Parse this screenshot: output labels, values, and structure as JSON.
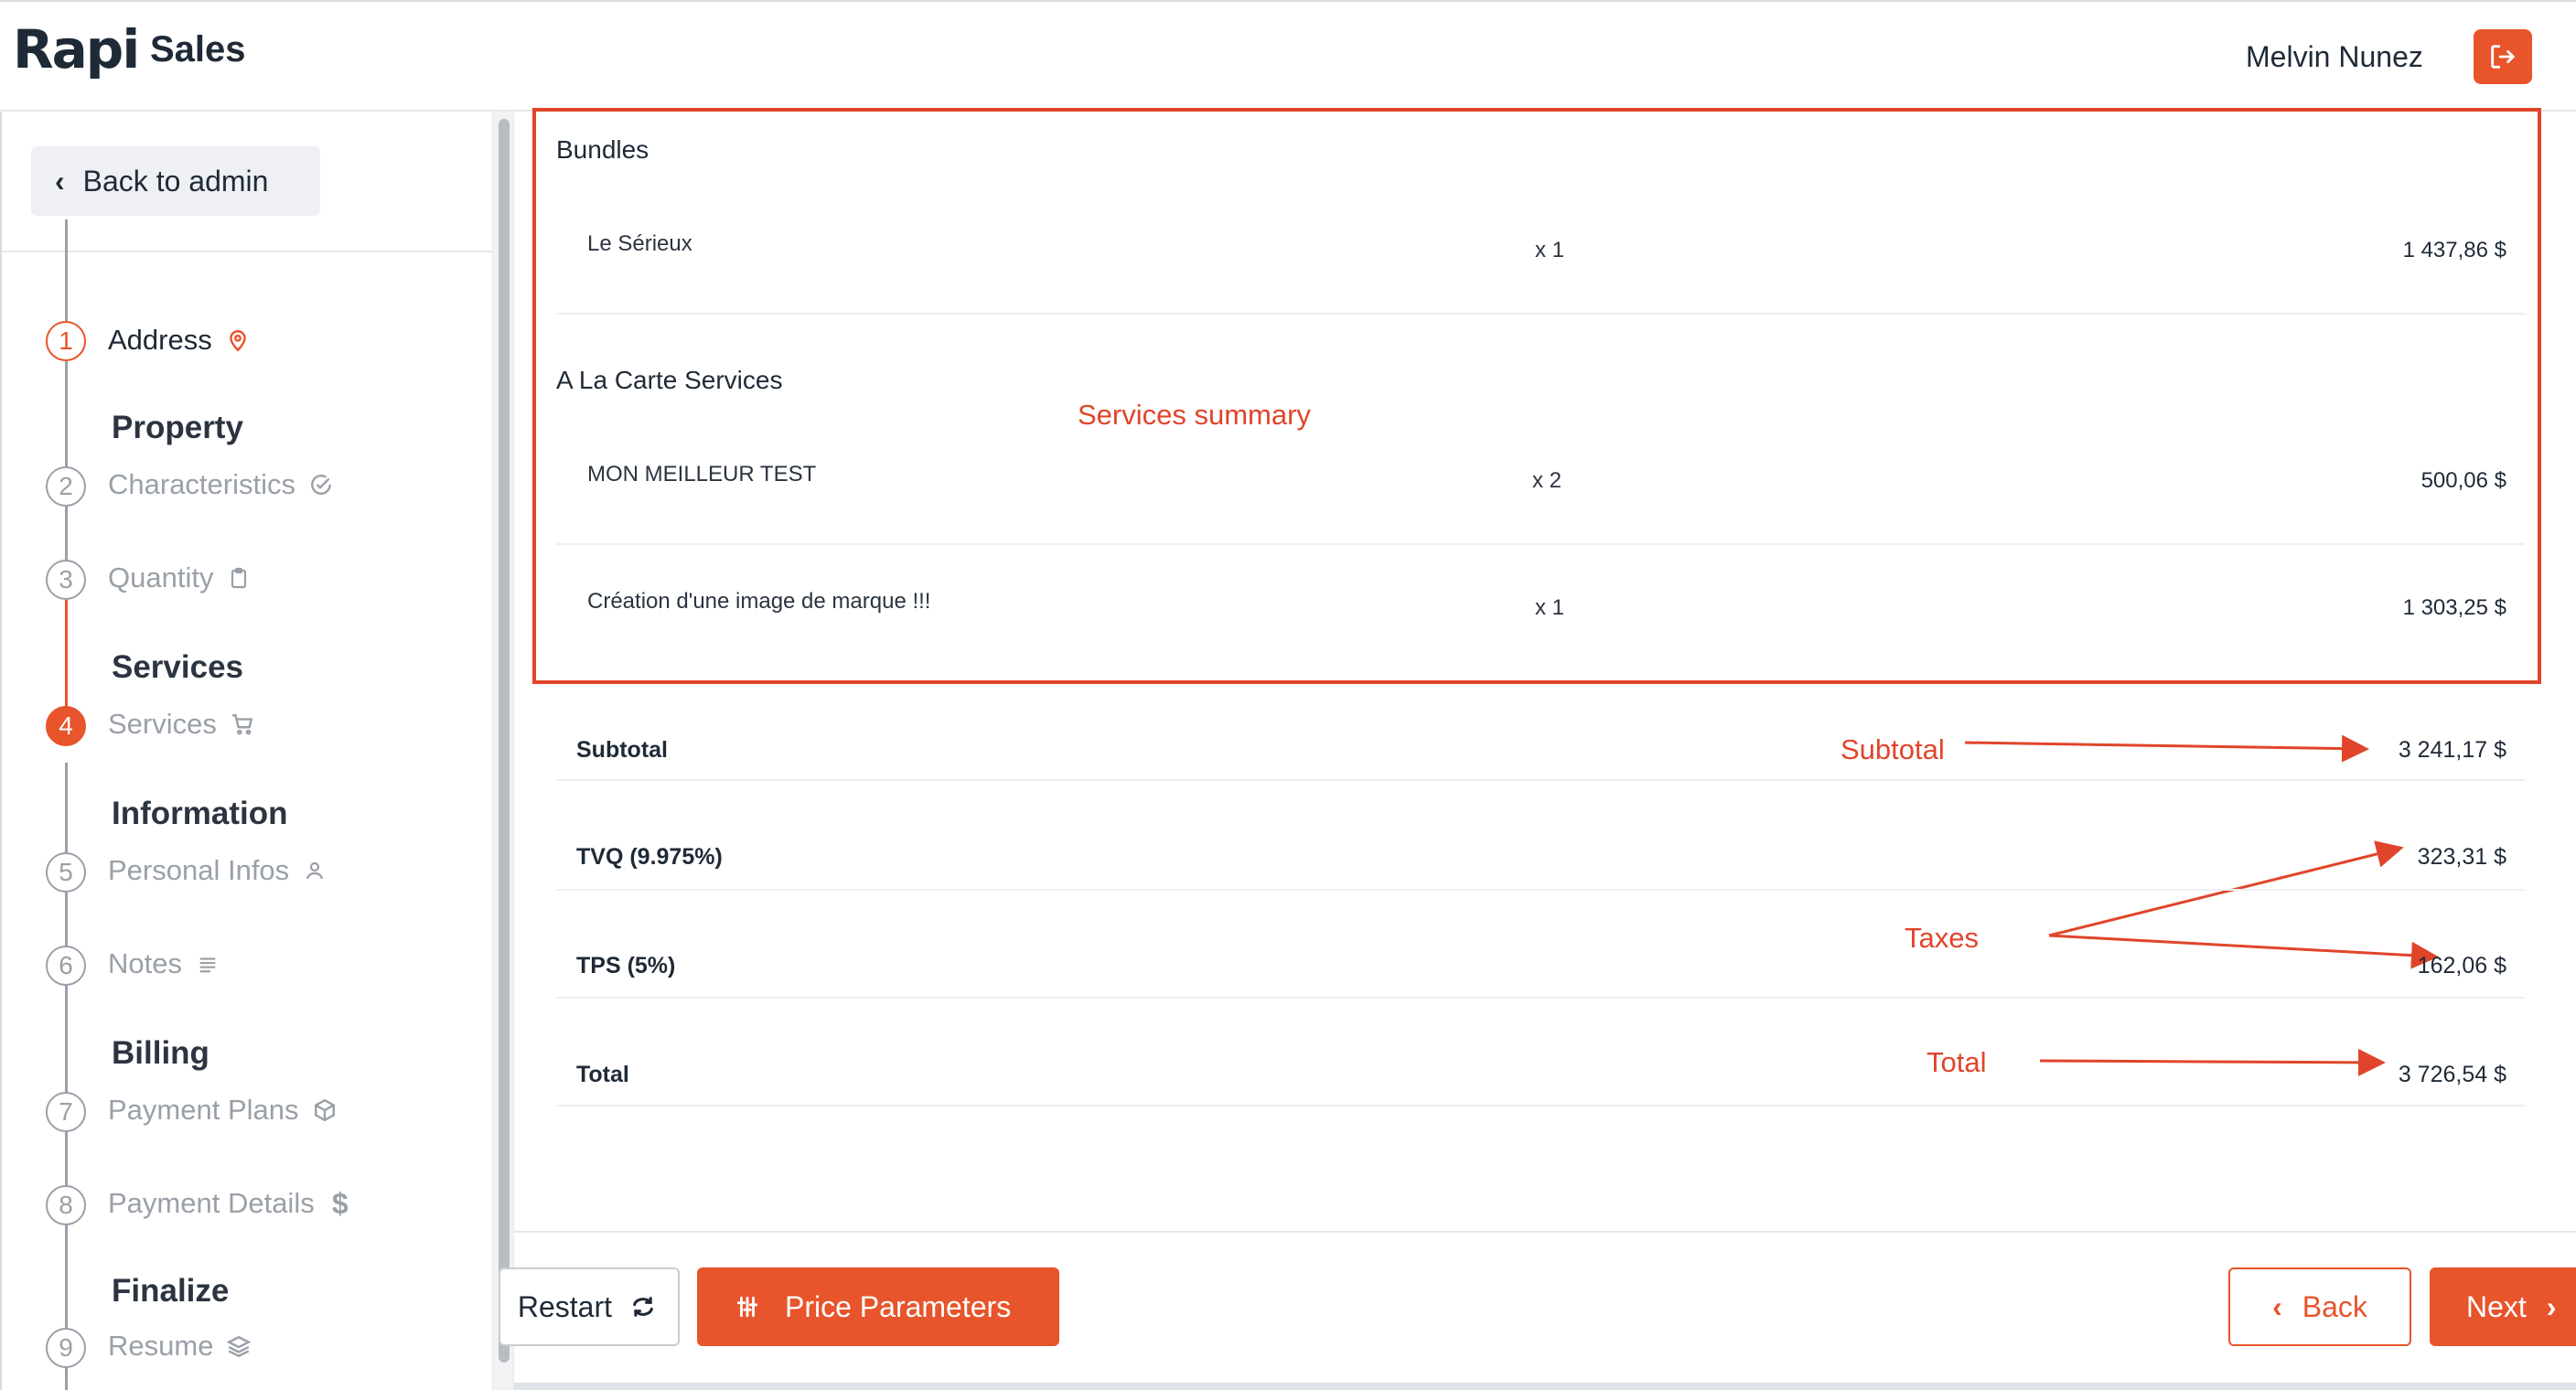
{
  "header": {
    "logo": "Rapi",
    "app_title": "Sales",
    "user_name": "Melvin Nunez",
    "logout_icon": "logout-icon"
  },
  "sidebar": {
    "back_label": "Back to admin",
    "steps": [
      {
        "number": "1",
        "section": "",
        "label": "Address",
        "icon": "location-pin-icon",
        "state": "active"
      },
      {
        "number": "2",
        "section": "Property",
        "label": "Characteristics",
        "icon": "check-circle-icon",
        "state": "done"
      },
      {
        "number": "3",
        "section": "",
        "label": "Quantity",
        "icon": "clipboard-icon",
        "state": "done"
      },
      {
        "number": "4",
        "section": "Services",
        "label": "Services",
        "icon": "cart-icon",
        "state": "current"
      },
      {
        "number": "5",
        "section": "Information",
        "label": "Personal Infos",
        "icon": "user-icon",
        "state": "pending"
      },
      {
        "number": "6",
        "section": "",
        "label": "Notes",
        "icon": "notes-icon",
        "state": "pending"
      },
      {
        "number": "7",
        "section": "Billing",
        "label": "Payment Plans",
        "icon": "box-icon",
        "state": "pending"
      },
      {
        "number": "8",
        "section": "",
        "label": "Payment Details",
        "icon": "dollar-icon",
        "state": "pending"
      },
      {
        "number": "9",
        "section": "Finalize",
        "label": "Resume",
        "icon": "layers-icon",
        "state": "pending"
      }
    ]
  },
  "summary": {
    "bundles_title": "Bundles",
    "bundles": [
      {
        "name": "Le Sérieux",
        "qty": "x 1",
        "price": "1 437,86 $"
      }
    ],
    "alacarte_title": "A La Carte Services",
    "alacarte": [
      {
        "name": "MON MEILLEUR TEST",
        "qty": "x 2",
        "price": "500,06 $"
      },
      {
        "name": "Création d'une image de marque !!!",
        "qty": "x 1",
        "price": "1 303,25 $"
      }
    ]
  },
  "totals": {
    "subtotal_label": "Subtotal",
    "subtotal_value": "3 241,17 $",
    "tvq_label": "TVQ (9.975%)",
    "tvq_value": "323,31 $",
    "tps_label": "TPS (5%)",
    "tps_value": "162,06 $",
    "total_label": "Total",
    "total_value": "3 726,54 $"
  },
  "annotations": {
    "services_summary": "Services summary",
    "subtotal": "Subtotal",
    "taxes": "Taxes",
    "total": "Total",
    "color": "#e0452b"
  },
  "footer": {
    "restart_label": "Restart",
    "price_params_label": "Price Parameters",
    "back_label": "Back",
    "next_label": "Next"
  },
  "colors": {
    "accent": "#e8542b",
    "text": "#1f2a37",
    "muted": "#9aa0a8"
  }
}
